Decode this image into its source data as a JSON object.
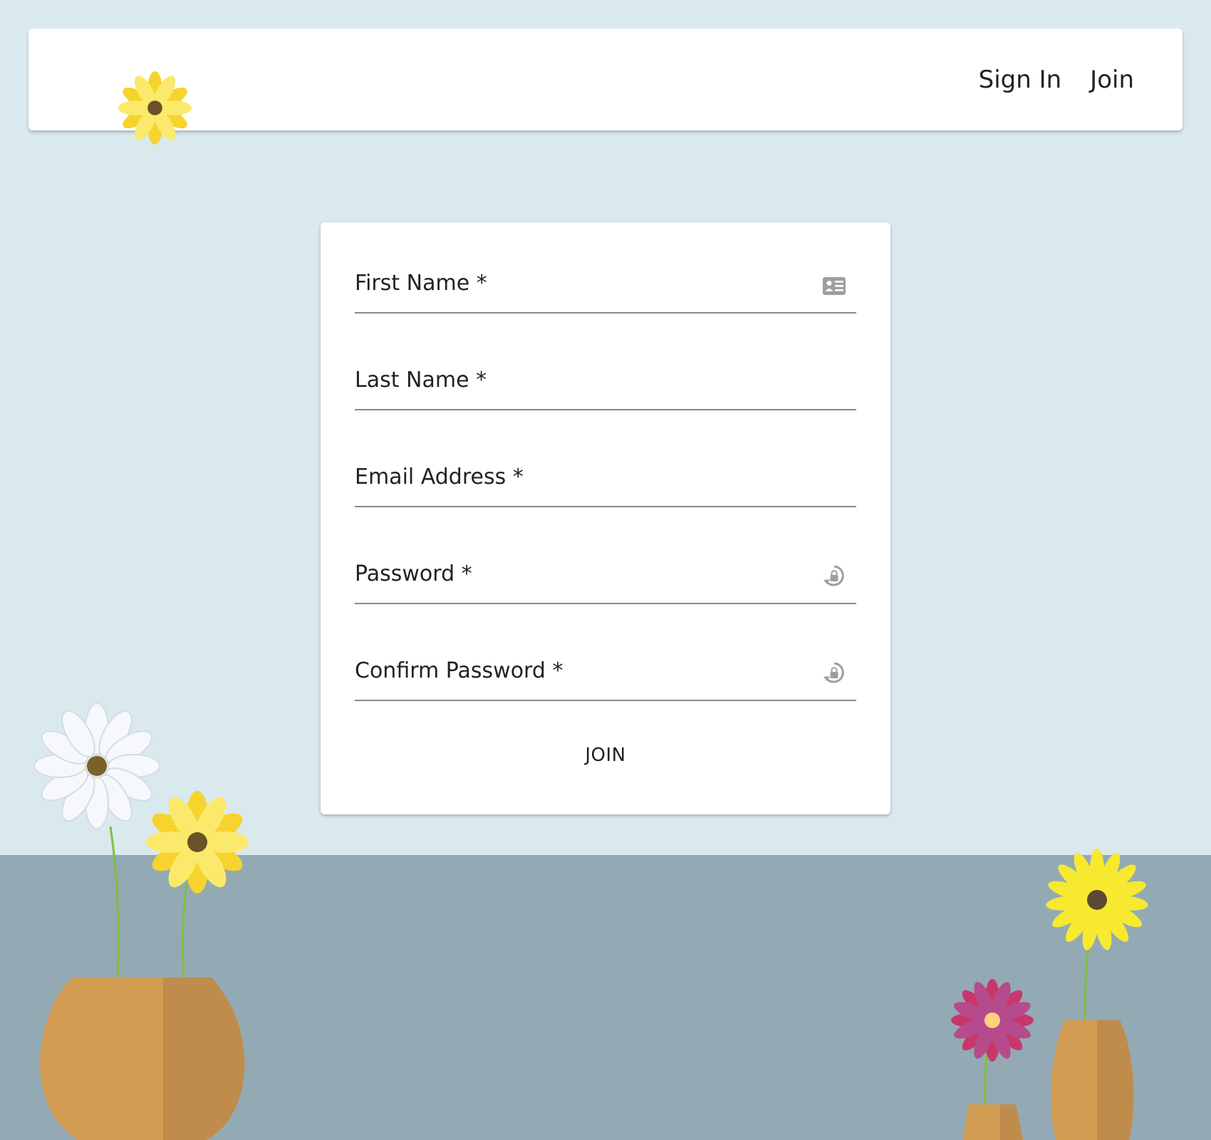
{
  "navbar": {
    "logo_icon": "sunflower-icon",
    "links": [
      "Sign In",
      "Join"
    ]
  },
  "form": {
    "fields": [
      {
        "label": "First Name *",
        "value": "",
        "icon": "contact-card-icon"
      },
      {
        "label": "Last Name *",
        "value": ""
      },
      {
        "label": "Email Address *",
        "value": ""
      },
      {
        "label": "Password *",
        "value": "",
        "icon": "lock-refresh-icon"
      },
      {
        "label": "Confirm Password *",
        "value": "",
        "icon": "lock-refresh-icon"
      }
    ],
    "submit_label": "JOIN"
  },
  "decorations": [
    "white-daisy-icon",
    "yellow-flower-icon",
    "orange-round-vase-icon",
    "pink-flower-icon",
    "small-vase-icon",
    "yellow-daisy-icon",
    "tall-vase-icon"
  ],
  "colors": {
    "wall": "#dae9ee",
    "floor": "#93aab4",
    "vase": "#d29b52",
    "vase_shade": "#bf8c4b",
    "petal_yellow": "#f6d32d",
    "petal_light_yellow": "#fbe96b",
    "flower_center": "#6a5229",
    "pink": "#c8376b",
    "stem": "#7fbf3f"
  }
}
